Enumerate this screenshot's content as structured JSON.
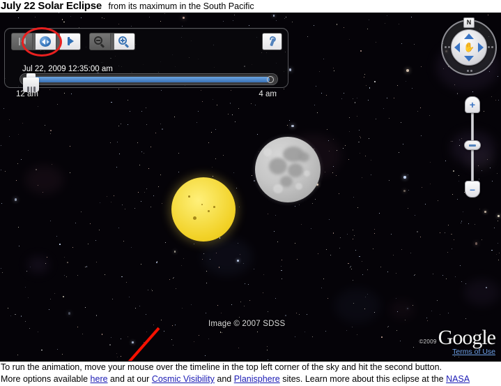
{
  "header": {
    "title_main": "July 22 Solar Eclipse",
    "title_sub": "from its maximum in the South Pacific"
  },
  "timeline": {
    "datetime": "Jul 22, 2009  12:35:00 am",
    "start_label": "12 am",
    "end_label": "4 am",
    "buttons": [
      {
        "name": "jump-to-start-button",
        "icon": "skip-to-start-icon",
        "state": "dark"
      },
      {
        "name": "play-animation-button",
        "icon": "play-reverse-icon",
        "state": "light"
      },
      {
        "name": "step-forward-button",
        "icon": "step-forward-icon",
        "state": "light"
      },
      {
        "name": "zoom-out-timeline-button",
        "icon": "magnifier-minus-icon",
        "state": "dark"
      },
      {
        "name": "zoom-in-timeline-button",
        "icon": "magnifier-plus-icon",
        "state": "light"
      }
    ],
    "options_button_icon": "wrench-icon"
  },
  "annotations": {
    "circle_target": "play-animation-button",
    "circle_color": "#e8201f",
    "arrow_color": "#f51100"
  },
  "navigation": {
    "compass_north_label": "N",
    "pan_icon": "hand-icon",
    "arrows": [
      "up-arrow-icon",
      "down-arrow-icon",
      "left-arrow-icon",
      "right-arrow-icon"
    ],
    "zoom_in_label": "+",
    "zoom_out_label": "–"
  },
  "sky": {
    "image_credit": "Image © 2007 SDSS",
    "objects": [
      {
        "name": "sun",
        "color": "#f2d228"
      },
      {
        "name": "moon",
        "color": "#c6c6c6"
      }
    ]
  },
  "branding": {
    "copyright": "©2009",
    "wordmark": "Google",
    "terms_label": "Terms of Use"
  },
  "footer": {
    "line1": "To run the animation, move your mouse over the timeline in the top left corner of the sky and hit the second button.",
    "line2_parts": {
      "p1": "More options available ",
      "link1": "here",
      "p2": " and at our ",
      "link2": "Cosmic Visibility",
      "p3": " and ",
      "link3": "Planisphere",
      "p4": " sites. Learn more about this eclipse at the ",
      "link4": "NASA"
    }
  }
}
